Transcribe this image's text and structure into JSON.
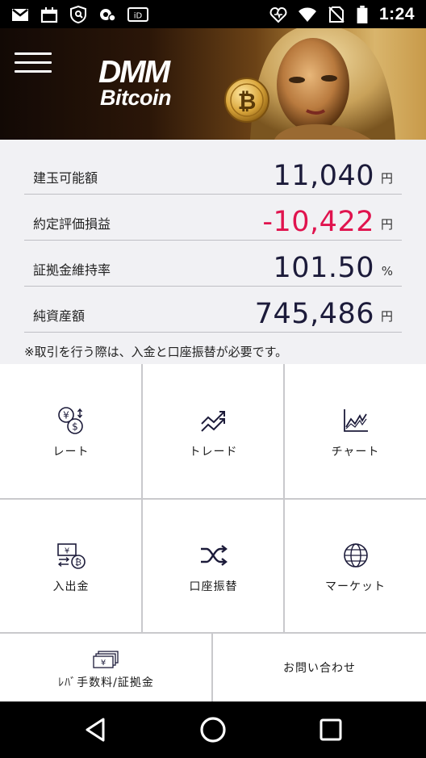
{
  "status_bar": {
    "time": "1:24",
    "left_icons": [
      "gmail-icon",
      "calendar-icon",
      "vpn-shield-icon",
      "settings-cog-icon",
      "id-icon"
    ],
    "right_icons": [
      "heart-signal-icon",
      "wifi-icon",
      "no-sim-icon",
      "battery-icon"
    ]
  },
  "header": {
    "logo_line1": "DMM",
    "logo_line2": "Bitcoin"
  },
  "summary": {
    "rows": [
      {
        "label": "建玉可能額",
        "value": "11,040",
        "unit": "円"
      },
      {
        "label": "約定評価損益",
        "value": "-10,422",
        "unit": "円"
      },
      {
        "label": "証拠金維持率",
        "value": "101.50",
        "unit": "%"
      },
      {
        "label": "純資産額",
        "value": "745,486",
        "unit": "円"
      }
    ],
    "notice": "※取引を行う際は、入金と口座振替が必要です。"
  },
  "menu": {
    "rate": "レート",
    "trade": "トレード",
    "chart": "チャート",
    "deposit": "入出金",
    "transfer": "口座振替",
    "market": "マーケット",
    "leverage_fee": "ﾚﾊﾞ手数料/証拠金",
    "contact": "お問い合わせ"
  },
  "colors": {
    "negative": "#e0134e",
    "value": "#1c1b3a",
    "summary_bg": "#f1f1f4",
    "icon": "#1c1b3a"
  }
}
